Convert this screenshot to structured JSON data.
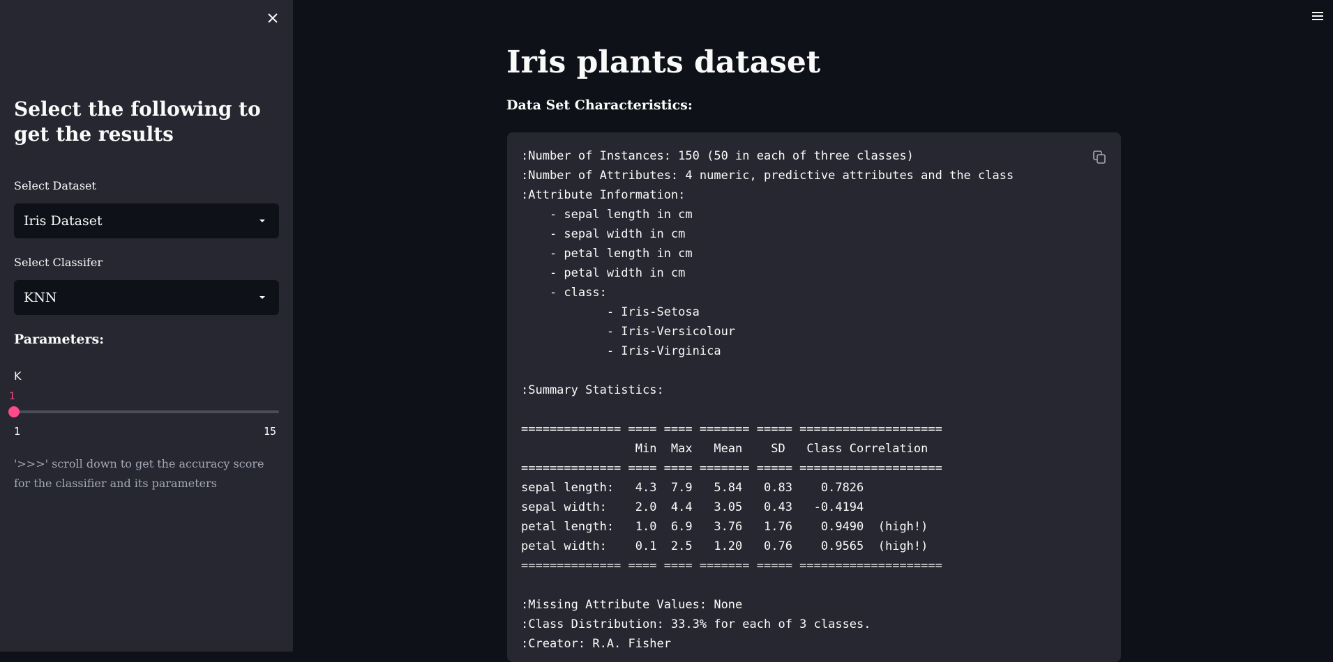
{
  "sidebar": {
    "heading": "Select the following to get the results",
    "dataset_label": "Select Dataset",
    "dataset_value": "Iris Dataset",
    "classifier_label": "Select Classifer",
    "classifier_value": "KNN",
    "parameters_heading": "Parameters:",
    "k_label": "K",
    "k_slider": {
      "value": "1",
      "min": "1",
      "max": "15",
      "fraction": 0
    },
    "note": "'>>>' scroll down to get the accuracy score for the classifier and its parameters"
  },
  "main": {
    "title": "Iris plants dataset",
    "subheading": "Data Set Characteristics:",
    "description": ":Number of Instances: 150 (50 in each of three classes)\n:Number of Attributes: 4 numeric, predictive attributes and the class\n:Attribute Information:\n    - sepal length in cm\n    - sepal width in cm\n    - petal length in cm\n    - petal width in cm\n    - class:\n            - Iris-Setosa\n            - Iris-Versicolour\n            - Iris-Virginica\n\n:Summary Statistics:\n\n============== ==== ==== ======= ===== ====================\n                Min  Max   Mean    SD   Class Correlation\n============== ==== ==== ======= ===== ====================\nsepal length:   4.3  7.9   5.84   0.83    0.7826\nsepal width:    2.0  4.4   3.05   0.43   -0.4194\npetal length:   1.0  6.9   3.76   1.76    0.9490  (high!)\npetal width:    0.1  2.5   1.20   0.76    0.9565  (high!)\n============== ==== ==== ======= ===== ====================\n\n:Missing Attribute Values: None\n:Class Distribution: 33.3% for each of 3 classes.\n:Creator: R.A. Fisher"
  },
  "icons": {
    "close": "close-icon",
    "caret": "chevron-down-icon",
    "copy": "copy-icon",
    "menu": "hamburger-menu-icon"
  },
  "colors": {
    "background": "#0e1117",
    "sidebar": "#262730",
    "accent": "#ff4b8b"
  }
}
